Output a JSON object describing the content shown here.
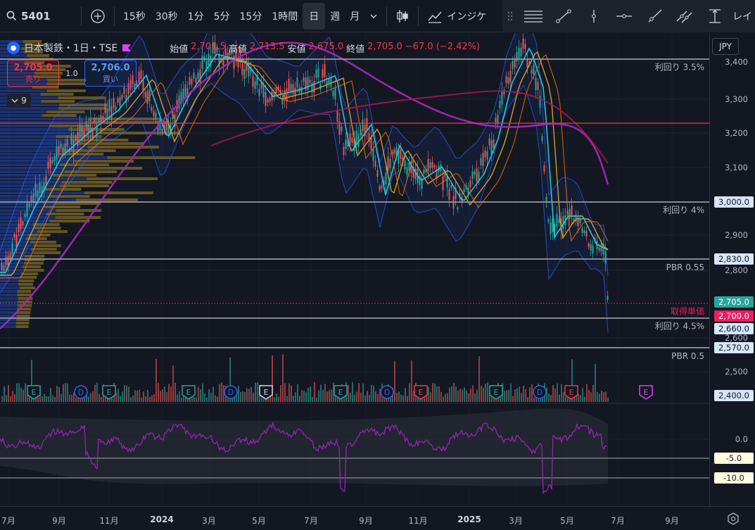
{
  "toolbar": {
    "symbol": "5401",
    "intervals": [
      "15秒",
      "30秒",
      "1分",
      "5分",
      "15分",
      "1時間",
      "日",
      "週",
      "月"
    ],
    "active_interval": "日",
    "indicators_label": "インジケ",
    "layout_label": "レイ"
  },
  "legend": {
    "title": "日本製鉄・1日・TSE",
    "open_label": "始値",
    "open": "2,701.5",
    "high_label": "高値",
    "high": "2,713.5",
    "low_label": "安値",
    "low": "2,675.0",
    "close_label": "終値",
    "close": "2,705.0",
    "change": "−67.0 (−2.42%)",
    "sell_price": "2,705.0",
    "sell_label": "売り",
    "buy_price": "2,706.0",
    "buy_label": "買い",
    "spread": "1.0",
    "indicator_count": "9"
  },
  "currency": "JPY",
  "price_axis": {
    "ticks": [
      "3,400",
      "3,300",
      "3,200",
      "3,100",
      "2,900",
      "2,800",
      "2,600",
      "2,500",
      "0.0"
    ],
    "tags": {
      "line_3000": "3,000.0",
      "line_2830": "2,830.0",
      "current": "2,705.0",
      "cost": "2,700.0",
      "line_2660": "2,660.0",
      "line_2570": "2,570.0",
      "line_2400": "2,400.0",
      "osc_m5": "-5.0",
      "osc_m10": "-10.0"
    }
  },
  "horizontal_lines": {
    "yield_35": "利回り 3.5%",
    "yield_4": "利回り 4%",
    "pbr_055": "PBR 0.55",
    "cost": "取得単価",
    "yield_45": "利回り 4.5%",
    "pbr_05": "PBR 0.5"
  },
  "time_axis": [
    "7月",
    "9月",
    "11月",
    "2024",
    "3月",
    "5月",
    "7月",
    "9月",
    "11月",
    "2025",
    "3月",
    "5月",
    "7月",
    "9月"
  ],
  "events": [
    "E",
    "D",
    "E",
    "E",
    "D",
    "E",
    "E",
    "D",
    "E",
    "E",
    "D",
    "E",
    "E"
  ],
  "colors": {
    "background": "#131722",
    "up": "#26a69a",
    "down": "#ef5350",
    "cost_line": "#e91e63",
    "resistance": "#f23645",
    "ma_long": "#9c27b0",
    "oscillator": "#8e24aa"
  }
}
